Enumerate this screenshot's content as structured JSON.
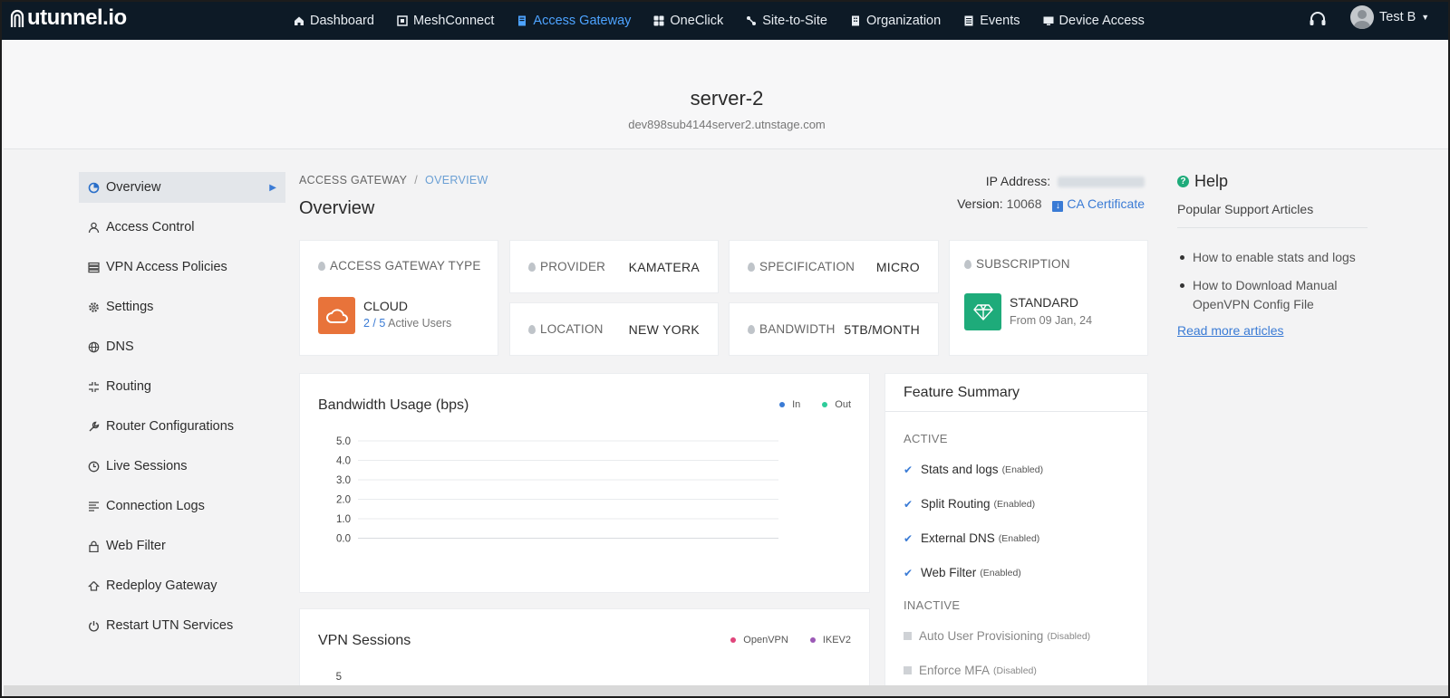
{
  "brand": {
    "logo_text": "utunnel.io"
  },
  "nav": {
    "items": [
      {
        "label": "Dashboard",
        "icon": "home-icon"
      },
      {
        "label": "MeshConnect",
        "icon": "mesh-icon"
      },
      {
        "label": "Access Gateway",
        "icon": "server-icon",
        "active": true
      },
      {
        "label": "OneClick",
        "icon": "grid-icon"
      },
      {
        "label": "Site-to-Site",
        "icon": "link-icon"
      },
      {
        "label": "Organization",
        "icon": "building-icon"
      },
      {
        "label": "Events",
        "icon": "list-icon"
      },
      {
        "label": "Device Access",
        "icon": "monitor-icon"
      }
    ],
    "user_name": "Test B"
  },
  "header": {
    "server_name": "server-2",
    "host": "dev898sub4144server2.utnstage.com"
  },
  "sidebar": {
    "items": [
      {
        "label": "Overview",
        "icon": "pie-icon",
        "active": true
      },
      {
        "label": "Access Control",
        "icon": "user-icon"
      },
      {
        "label": "VPN Access Policies",
        "icon": "policy-icon"
      },
      {
        "label": "Settings",
        "icon": "gear-icon"
      },
      {
        "label": "DNS",
        "icon": "globe-icon"
      },
      {
        "label": "Routing",
        "icon": "routing-icon"
      },
      {
        "label": "Router Configurations",
        "icon": "wrench-icon"
      },
      {
        "label": "Live Sessions",
        "icon": "clock-icon"
      },
      {
        "label": "Connection Logs",
        "icon": "logs-icon"
      },
      {
        "label": "Web Filter",
        "icon": "lock-icon"
      },
      {
        "label": "Redeploy Gateway",
        "icon": "redeploy-icon"
      },
      {
        "label": "Restart UTN Services",
        "icon": "power-icon"
      }
    ]
  },
  "breadcrumb": {
    "root": "ACCESS GATEWAY",
    "sep": "/",
    "current": "OVERVIEW"
  },
  "page": {
    "title": "Overview"
  },
  "info": {
    "ip_label": "IP Address:",
    "version_label": "Version:",
    "version_value": "10068",
    "ca_label": "CA Certificate"
  },
  "cards": {
    "type": {
      "label": "ACCESS GATEWAY TYPE",
      "value": "CLOUD",
      "users_active": "2 / 5",
      "users_suffix": "Active Users"
    },
    "provider": {
      "label": "PROVIDER",
      "value": "KAMATERA"
    },
    "location": {
      "label": "LOCATION",
      "value": "NEW YORK"
    },
    "specification": {
      "label": "SPECIFICATION",
      "value": "MICRO"
    },
    "bandwidth": {
      "label": "BANDWIDTH",
      "value": "5TB/MONTH"
    },
    "subscription": {
      "label": "SUBSCRIPTION",
      "value": "STANDARD",
      "since": "From 09 Jan, 24"
    }
  },
  "bandwidth_chart": {
    "title": "Bandwidth Usage (bps)",
    "legend": [
      {
        "name": "In",
        "color": "#3a7bd5"
      },
      {
        "name": "Out",
        "color": "#2ecc9a"
      }
    ]
  },
  "vpn_chart": {
    "title": "VPN Sessions",
    "legend": [
      {
        "name": "OpenVPN",
        "color": "#e0457b"
      },
      {
        "name": "IKEV2",
        "color": "#9b59b6"
      }
    ]
  },
  "chart_data": [
    {
      "type": "line",
      "title": "Bandwidth Usage (bps)",
      "series": [
        {
          "name": "In",
          "values": []
        },
        {
          "name": "Out",
          "values": []
        }
      ],
      "y_ticks": [
        "5.0",
        "4.0",
        "3.0",
        "2.0",
        "1.0",
        "0.0"
      ],
      "ylim": [
        0,
        5
      ],
      "grid": true,
      "legend": "top-right"
    },
    {
      "type": "line",
      "title": "VPN Sessions",
      "series": [
        {
          "name": "OpenVPN",
          "values": []
        },
        {
          "name": "IKEV2",
          "values": []
        }
      ],
      "y_ticks": [
        "5"
      ],
      "legend": "top-right"
    }
  ],
  "features": {
    "title": "Feature Summary",
    "active_label": "ACTIVE",
    "inactive_label": "INACTIVE",
    "active": [
      {
        "name": "Stats and logs",
        "status": "(Enabled)"
      },
      {
        "name": "Split Routing",
        "status": "(Enabled)"
      },
      {
        "name": "External DNS",
        "status": "(Enabled)"
      },
      {
        "name": "Web Filter",
        "status": "(Enabled)"
      }
    ],
    "inactive": [
      {
        "name": "Auto User Provisioning",
        "status": "(Disabled)"
      },
      {
        "name": "Enforce MFA",
        "status": "(Disabled)"
      }
    ]
  },
  "help": {
    "title": "Help",
    "subtitle": "Popular Support Articles",
    "articles": [
      "How to enable stats and logs",
      "How to Download Manual OpenVPN Config File"
    ],
    "more": "Read more articles"
  }
}
